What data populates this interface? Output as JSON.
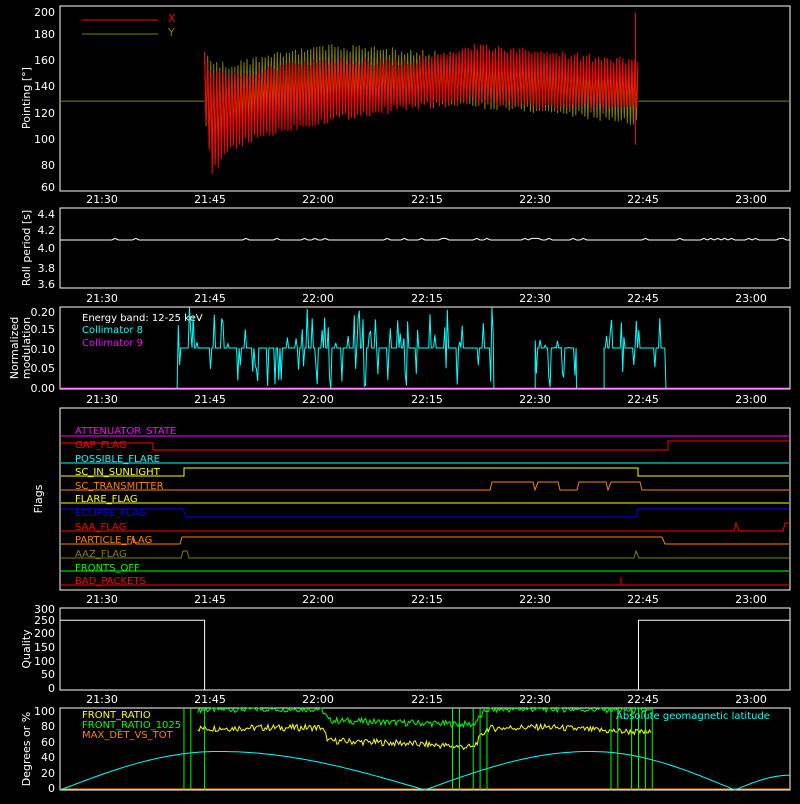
{
  "panels": [
    {
      "id": "pointing",
      "ylabel": "Pointing [°]",
      "yticks": [
        "60",
        "80",
        "100",
        "120",
        "140",
        "160",
        "180",
        "200"
      ],
      "legend": [
        {
          "label": "X",
          "color": "#ff0000"
        },
        {
          "label": "Y",
          "color": "#808000"
        }
      ]
    },
    {
      "id": "roll",
      "ylabel": "Roll period [s]",
      "yticks": [
        "3.6",
        "3.8",
        "4.0",
        "4.2",
        "4.4"
      ]
    },
    {
      "id": "modulation",
      "ylabel_line1": "Normalized",
      "ylabel_line2": "modulation",
      "yticks": [
        "0.00",
        "0.05",
        "0.10",
        "0.15",
        "0.20"
      ],
      "legend": [
        {
          "label": "Energy band: 12-25 keV",
          "color": "#ffffff"
        },
        {
          "label": "Collimator 8",
          "color": "#00ffff"
        },
        {
          "label": "Collimator 9",
          "color": "#ff00ff"
        }
      ]
    },
    {
      "id": "flags",
      "ylabel": "Flags"
    },
    {
      "id": "quality",
      "ylabel": "Quality",
      "yticks": [
        "0",
        "50",
        "100",
        "150",
        "200",
        "250",
        "300"
      ]
    },
    {
      "id": "ratios",
      "ylabel": "Degrees or %",
      "yticks": [
        "0",
        "20",
        "40",
        "60",
        "80",
        "100"
      ],
      "legend": [
        {
          "label": "FRONT_RATIO",
          "color": "#ffff00"
        },
        {
          "label": "FRONT_RATIO_1025",
          "color": "#00ff00"
        },
        {
          "label": "MAX_DET_VS_TOT",
          "color": "#ff8000"
        }
      ],
      "legend_right": {
        "label": "Absolute geomagnetic latitude",
        "color": "#00ffff"
      }
    }
  ],
  "xticks": [
    "21:30",
    "21:45",
    "22:00",
    "22:15",
    "22:30",
    "22:45",
    "23:00"
  ],
  "flags": [
    {
      "label": "ATTENUATOR_STATE",
      "color": "#ff00ff"
    },
    {
      "label": "GAP_FLAG",
      "color": "#ff0000"
    },
    {
      "label": "POSSIBLE_FLARE",
      "color": "#00ffff"
    },
    {
      "label": "SC_IN_SUNLIGHT",
      "color": "#ffff00"
    },
    {
      "label": "SC_TRANSMITTER",
      "color": "#ff8000"
    },
    {
      "label": "FLARE_FLAG",
      "color": "#ffff00"
    },
    {
      "label": "ECLIPSE_FLAG",
      "color": "#0000ff"
    },
    {
      "label": "SAA_FLAG",
      "color": "#ff0000"
    },
    {
      "label": "PARTICLE_FLAG",
      "color": "#ff8000"
    },
    {
      "label": "AAZ_FLAG",
      "color": "#808000"
    },
    {
      "label": "FRONTS_OFF",
      "color": "#00ff00"
    },
    {
      "label": "BAD_PACKETS",
      "color": "#ff0000"
    }
  ],
  "chart_data": [
    {
      "type": "line",
      "ylabel": "Pointing [°]",
      "ylim": [
        60,
        200
      ],
      "x_range": [
        "21:20",
        "23:06"
      ],
      "series": [
        {
          "name": "X",
          "color": "#ff0000",
          "envelope": [
            {
              "t": "21:41",
              "lo": 120,
              "hi": 165
            },
            {
              "t": "21:42",
              "lo": 70,
              "hi": 155
            },
            {
              "t": "21:45",
              "lo": 90,
              "hi": 150
            },
            {
              "t": "21:50",
              "lo": 100,
              "hi": 155
            },
            {
              "t": "22:00",
              "lo": 112,
              "hi": 162
            },
            {
              "t": "22:10",
              "lo": 120,
              "hi": 160
            },
            {
              "t": "22:20",
              "lo": 125,
              "hi": 172
            },
            {
              "t": "22:30",
              "lo": 120,
              "hi": 168
            },
            {
              "t": "22:40",
              "lo": 120,
              "hi": 162
            },
            {
              "t": "22:44",
              "lo": 122,
              "hi": 162
            }
          ],
          "outside_value": 128
        },
        {
          "name": "Y",
          "color": "#808000",
          "envelope": [
            {
              "t": "21:41",
              "lo": 110,
              "hi": 165
            },
            {
              "t": "21:42",
              "lo": 80,
              "hi": 160
            },
            {
              "t": "21:45",
              "lo": 100,
              "hi": 158
            },
            {
              "t": "21:50",
              "lo": 115,
              "hi": 165
            },
            {
              "t": "22:00",
              "lo": 120,
              "hi": 172
            },
            {
              "t": "22:10",
              "lo": 123,
              "hi": 168
            },
            {
              "t": "22:20",
              "lo": 122,
              "hi": 165
            },
            {
              "t": "22:30",
              "lo": 118,
              "hi": 162
            },
            {
              "t": "22:40",
              "lo": 112,
              "hi": 158
            },
            {
              "t": "22:44",
              "lo": 108,
              "hi": 155
            }
          ],
          "outside_value": 128
        }
      ]
    },
    {
      "type": "line",
      "ylabel": "Roll period [s]",
      "ylim": [
        3.5,
        4.5
      ],
      "series": [
        {
          "name": "",
          "color": "#ffffff",
          "value": 4.1,
          "from": "21:20",
          "to": "23:06"
        }
      ]
    },
    {
      "type": "line",
      "ylabel": "Normalized modulation",
      "ylim": [
        0.0,
        0.2
      ],
      "series": [
        {
          "name": "Collimator 8",
          "color": "#00ffff",
          "segments": [
            {
              "from": "21:37",
              "to": "22:23",
              "baseline": 0.1,
              "spikes_max": 0.2
            },
            {
              "from": "22:29",
              "to": "22:35",
              "baseline": 0.1,
              "spikes_max": 0.12
            },
            {
              "from": "22:39",
              "to": "22:48",
              "baseline": 0.1,
              "spikes_max": 0.19
            }
          ]
        },
        {
          "name": "Collimator 9",
          "color": "#ff00ff",
          "value": 0.0,
          "from": "21:20",
          "to": "23:06"
        }
      ]
    },
    {
      "type": "line",
      "ylabel": "Quality",
      "ylim": [
        0,
        300
      ],
      "series": [
        {
          "name": "",
          "color": "#ffffff",
          "steps": [
            {
              "from": "21:20",
              "to": "21:41",
              "value": 255
            },
            {
              "from": "21:41",
              "to": "22:44",
              "value": 0
            },
            {
              "from": "22:44",
              "to": "23:06",
              "value": 255
            }
          ]
        }
      ]
    },
    {
      "type": "line",
      "ylabel": "Degrees or %",
      "ylim": [
        0,
        100
      ],
      "series": [
        {
          "name": "FRONT_RATIO",
          "color": "#ffff00",
          "points": [
            [
              "21:40",
              75
            ],
            [
              "21:50",
              76
            ],
            [
              "21:58",
              76
            ],
            [
              "21:59",
              60
            ],
            [
              "22:10",
              57
            ],
            [
              "22:20",
              52
            ],
            [
              "22:22",
              75
            ],
            [
              "22:30",
              77
            ],
            [
              "22:40",
              72
            ],
            [
              "22:46",
              70
            ]
          ]
        },
        {
          "name": "FRONT_RATIO_1025",
          "color": "#00ff00",
          "points": [
            [
              "21:40",
              98
            ],
            [
              "21:50",
              99
            ],
            [
              "21:58",
              99
            ],
            [
              "21:59",
              85
            ],
            [
              "22:10",
              82
            ],
            [
              "22:20",
              80
            ],
            [
              "22:22",
              98
            ],
            [
              "22:30",
              99
            ],
            [
              "22:40",
              98
            ],
            [
              "22:46",
              96
            ]
          ]
        },
        {
          "name": "MAX_DET_VS_TOT",
          "color": "#ff8000",
          "value": 0
        },
        {
          "name": "Absolute geomagnetic latitude",
          "color": "#00ffff",
          "points": [
            [
              "21:20",
              0
            ],
            [
              "21:43",
              47
            ],
            [
              "22:13",
              0
            ],
            [
              "22:37",
              47
            ],
            [
              "22:58",
              0
            ],
            [
              "23:06",
              18
            ]
          ]
        }
      ]
    }
  ]
}
